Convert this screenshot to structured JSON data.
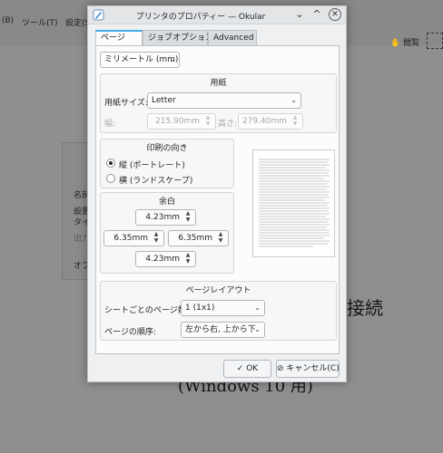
{
  "background": {
    "menu": [
      {
        "label": "(B)"
      },
      {
        "label": "ツール(T)"
      },
      {
        "label": "設定(S)"
      }
    ],
    "toolbar_browse": "閲覧",
    "page_text_top": "接続",
    "page_text_bottom": "(Windows 10 用)",
    "dialog_labels": [
      "名前",
      "設置",
      "タイ",
      "出力",
      "オプ"
    ]
  },
  "dialog": {
    "title": "プリンタのプロパティー — Okular",
    "tabs": [
      {
        "label": "ページ",
        "active": true
      },
      {
        "label": "ジョブオプション",
        "active": false
      },
      {
        "label": "Advanced",
        "active": false
      }
    ],
    "units_combo": "ミリメートル (mm)",
    "paper": {
      "group_title": "用紙",
      "size_label": "用紙サイズ:",
      "size_value": "Letter",
      "width_label": "幅:",
      "width_value": "215.90mm",
      "height_label": "高さ:",
      "height_value": "279.40mm"
    },
    "orientation": {
      "group_title": "印刷の向き",
      "options": [
        {
          "label": "縦 (ポートレート)",
          "checked": true
        },
        {
          "label": "横 (ランドスケープ)",
          "checked": false
        }
      ]
    },
    "margins": {
      "group_title": "余白",
      "top": "4.23mm",
      "left": "6.35mm",
      "right": "6.35mm",
      "bottom": "4.23mm"
    },
    "layout": {
      "group_title": "ページレイアウト",
      "pages_per_sheet_label": "シートごとのページ数:",
      "pages_per_sheet_value": "1 (1x1)",
      "page_order_label": "ページの順序:",
      "page_order_value": "左から右, 上から下"
    },
    "buttons": {
      "ok": "OK",
      "cancel": "キャンセル(C)"
    },
    "icons": {
      "ok": "check-icon",
      "cancel": "cancel-icon",
      "app": "okular-icon"
    },
    "colors": {
      "accent": "#3daee9",
      "dialog_bg": "#eff0f1"
    }
  }
}
